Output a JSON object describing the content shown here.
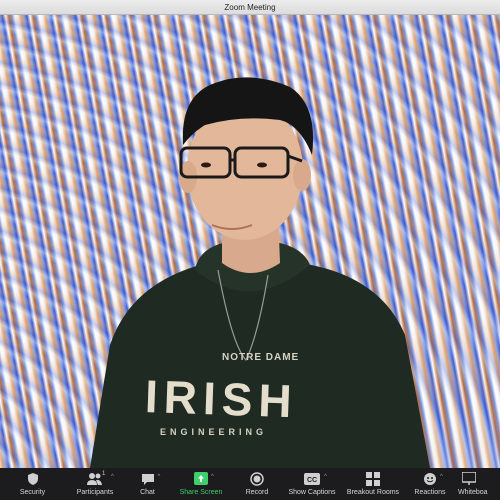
{
  "window": {
    "title": "Zoom Meeting"
  },
  "toolbar": {
    "items": [
      {
        "label": "Security",
        "icon": "shield-icon"
      },
      {
        "label": "Participants",
        "icon": "participants-icon",
        "count": "1"
      },
      {
        "label": "Chat",
        "icon": "chat-icon"
      },
      {
        "label": "Share Screen",
        "icon": "share-screen-icon",
        "accent": "#3ccf6a"
      },
      {
        "label": "Record",
        "icon": "record-icon"
      },
      {
        "label": "Show Captions",
        "icon": "captions-icon",
        "badge": "CC"
      },
      {
        "label": "Breakout Rooms",
        "icon": "breakout-rooms-icon"
      },
      {
        "label": "Reactions",
        "icon": "reactions-icon"
      },
      {
        "label": "Whiteboa",
        "icon": "whiteboard-icon"
      }
    ]
  },
  "video": {
    "shirt_text": {
      "top": "NOTRE DAME",
      "main": "IRISH",
      "bottom": "ENGINEERING"
    }
  },
  "colors": {
    "toolbar_bg": "#1c1c1e",
    "share_green": "#3ccf6a",
    "hoodie": "#1e2a22"
  }
}
